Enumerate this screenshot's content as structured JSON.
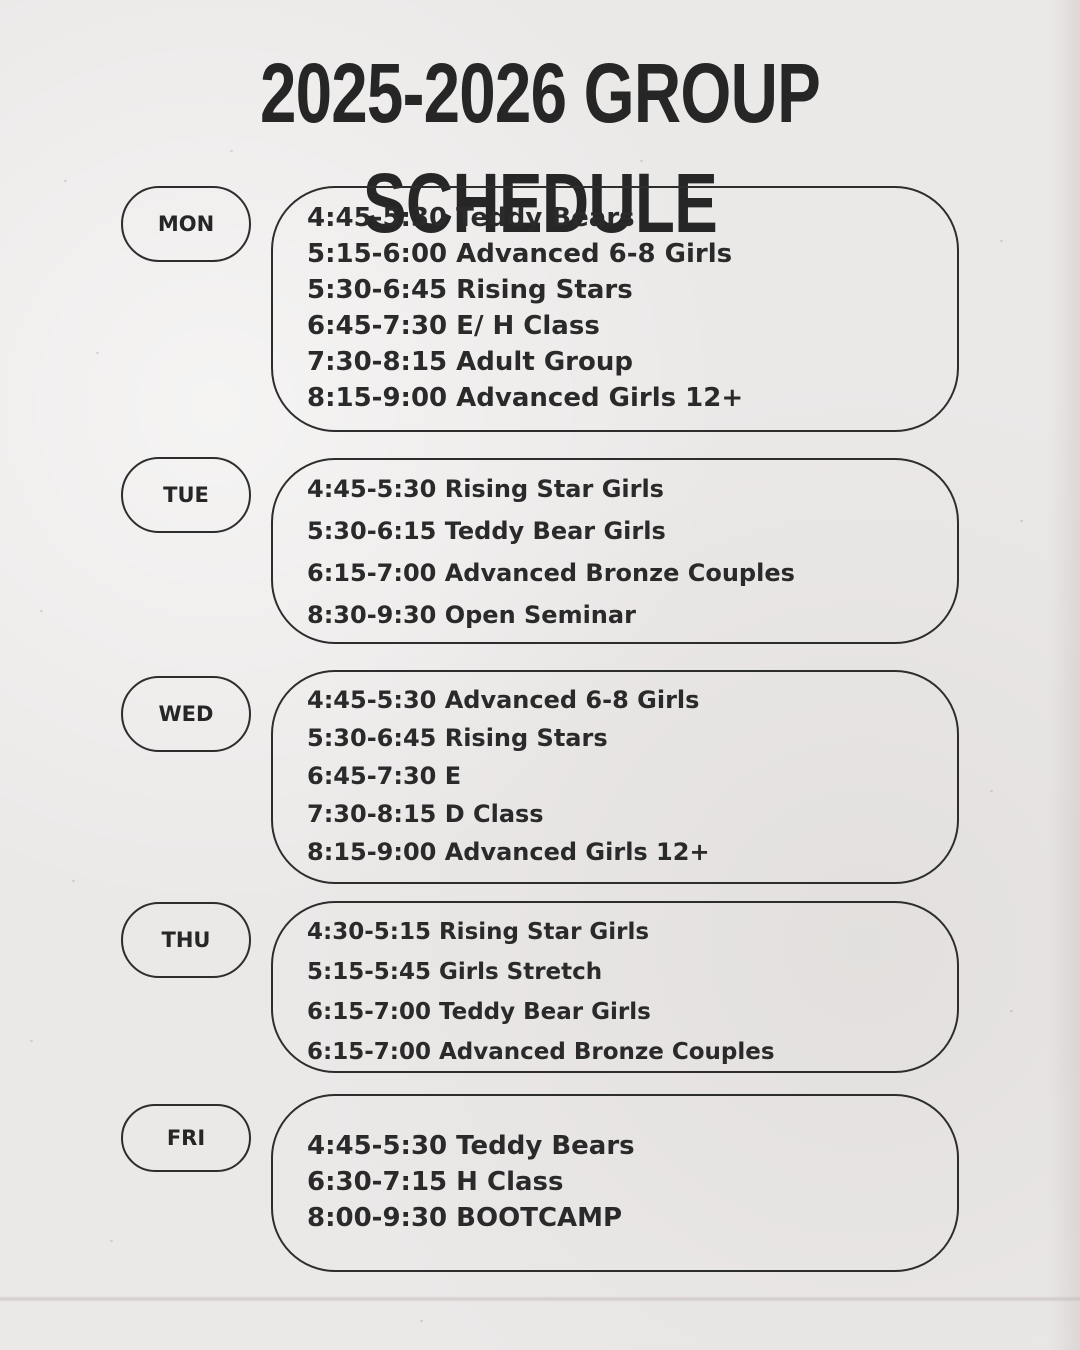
{
  "title": "2025-2026 GROUP SCHEDULE",
  "colors": {
    "background": "#ebe9e8",
    "ink": "#262626"
  },
  "days": [
    {
      "label": "MON",
      "sessions": [
        "4:45-5:30 Teddy Bears",
        "5:15-6:00 Advanced 6-8 Girls",
        "5:30-6:45 Rising Stars",
        "6:45-7:30 E/ H Class",
        "7:30-8:15 Adult Group",
        "8:15-9:00 Advanced Girls 12+"
      ]
    },
    {
      "label": "TUE",
      "sessions": [
        "4:45-5:30 Rising Star Girls",
        "5:30-6:15 Teddy Bear Girls",
        "6:15-7:00 Advanced Bronze Couples",
        "8:30-9:30 Open Seminar"
      ]
    },
    {
      "label": "WED",
      "sessions": [
        "4:45-5:30 Advanced 6-8 Girls",
        "5:30-6:45 Rising Stars",
        "6:45-7:30 E",
        "7:30-8:15 D Class",
        "8:15-9:00 Advanced Girls 12+"
      ]
    },
    {
      "label": "THU",
      "sessions": [
        "4:30-5:15 Rising Star Girls",
        "5:15-5:45 Girls Stretch",
        "6:15-7:00 Teddy Bear Girls",
        "6:15-7:00 Advanced Bronze Couples"
      ]
    },
    {
      "label": "FRI",
      "sessions": [
        "4:45-5:30 Teddy Bears",
        "6:30-7:15 H Class",
        "8:00-9:30 BOOTCAMP"
      ]
    }
  ]
}
